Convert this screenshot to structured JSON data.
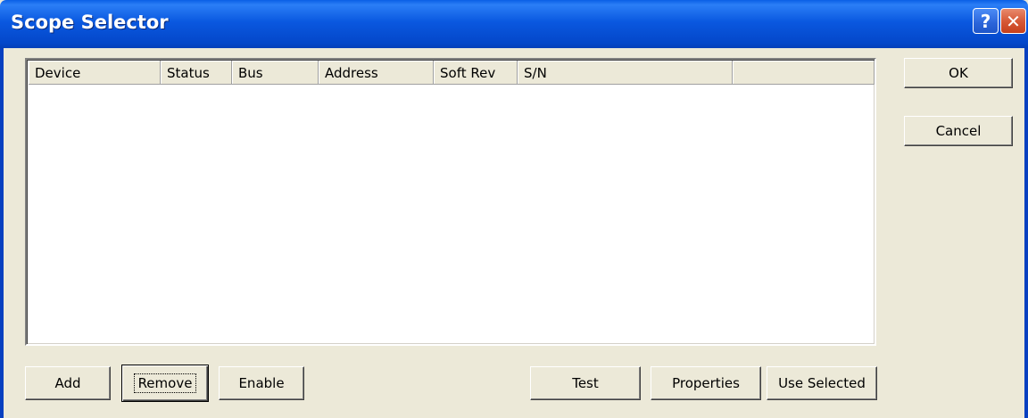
{
  "window": {
    "title": "Scope Selector"
  },
  "titlebar": {
    "help_glyph": "?",
    "close_glyph": "✕",
    "help_icon": "help-icon",
    "close_icon": "close-icon"
  },
  "list": {
    "columns": [
      "Device",
      "Status",
      "Bus",
      "Address",
      "Soft Rev",
      "S/N",
      ""
    ],
    "rows": []
  },
  "buttons": {
    "ok": "OK",
    "cancel": "Cancel",
    "add": "Add",
    "remove": "Remove",
    "enable": "Enable",
    "test": "Test",
    "properties": "Properties",
    "use_selected": "Use Selected"
  },
  "colors": {
    "titlebar": "#0a58e0",
    "dialog_bg": "#ece9d8",
    "close_button": "#d75a38"
  }
}
